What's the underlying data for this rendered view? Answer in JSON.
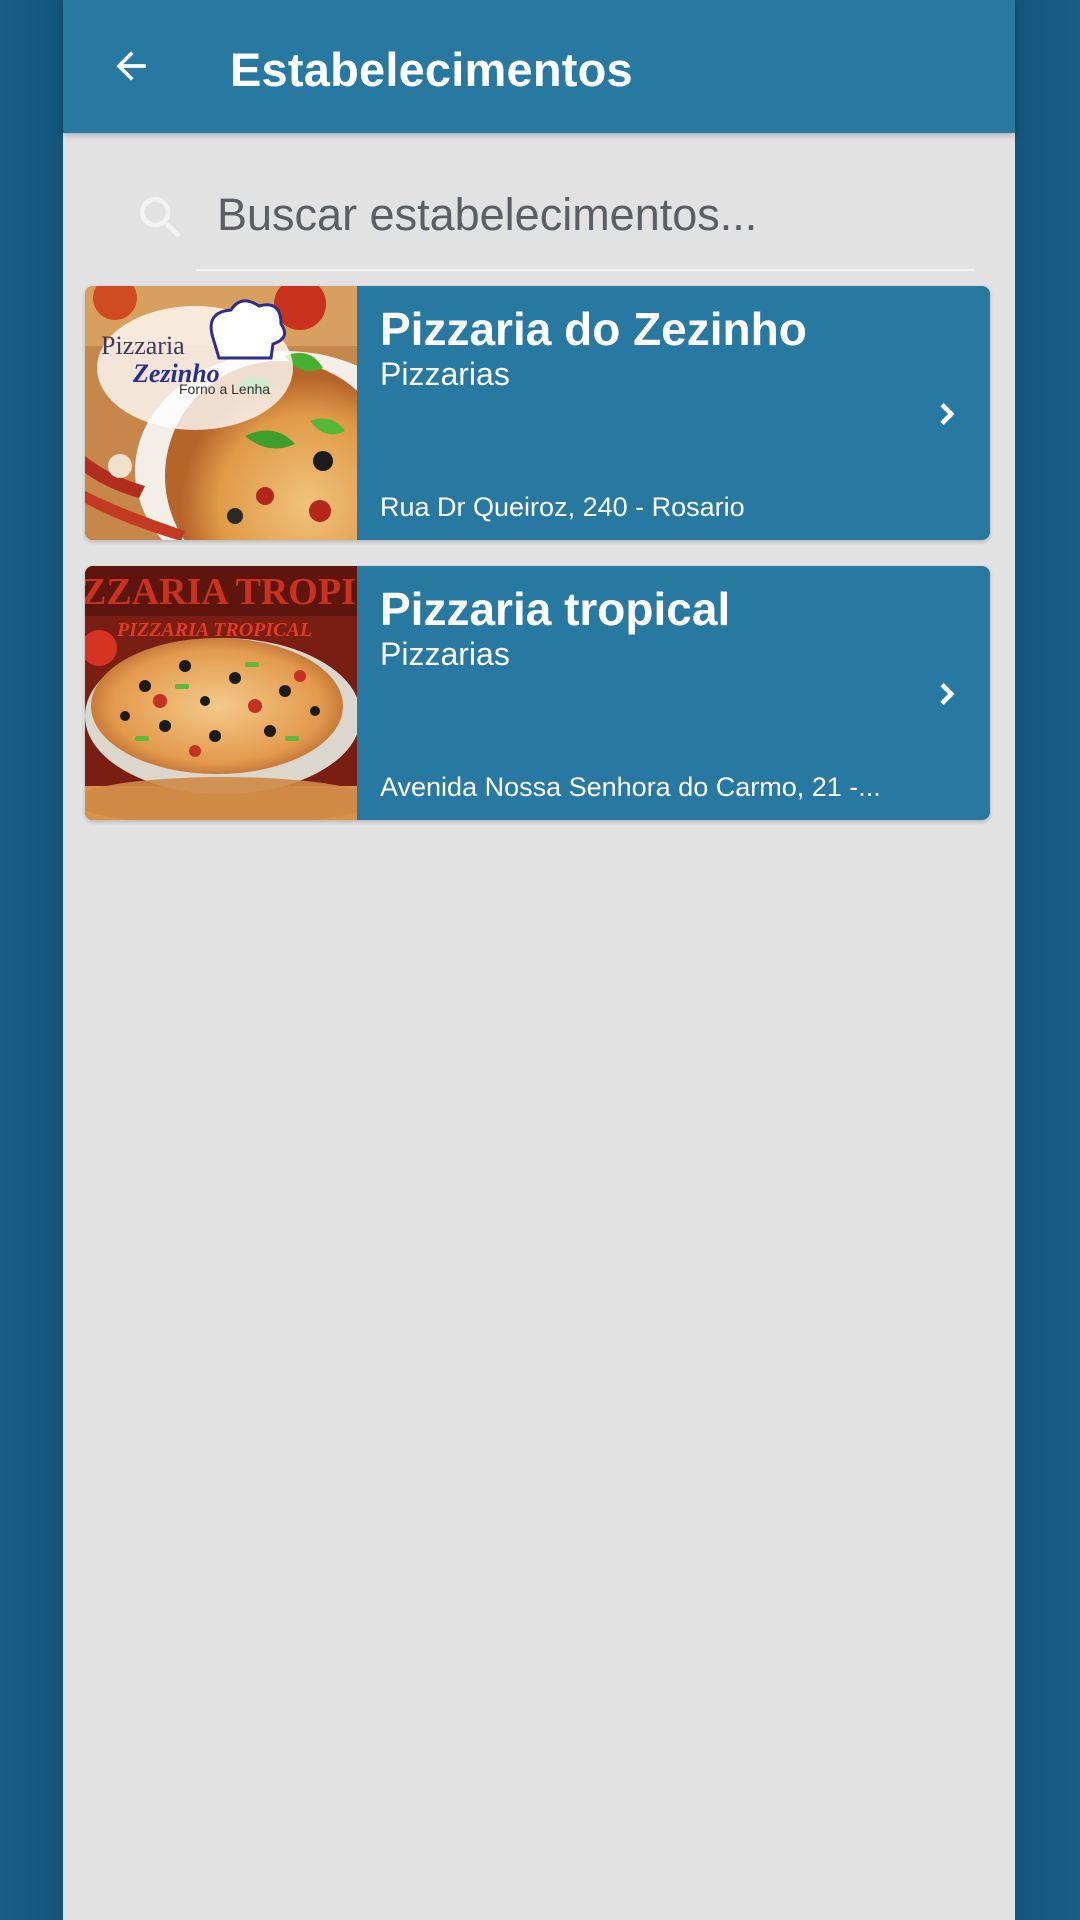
{
  "appbar": {
    "title": "Estabelecimentos",
    "back_icon": "arrow-left-icon",
    "color": "#2779a1"
  },
  "search": {
    "placeholder": "Buscar estabelecimentos...",
    "value": "",
    "icon": "search-icon"
  },
  "establishments": [
    {
      "name": "Pizzaria do Zezinho",
      "category": "Pizzarias",
      "address": "Rua Dr Queiroz, 240 - Rosario",
      "image_text": {
        "line1": "Pizzaria",
        "line2": "Zezinho",
        "line3": "Forno a Lenha"
      }
    },
    {
      "name": "Pizzaria tropical",
      "category": "Pizzarias",
      "address": "Avenida Nossa Senhora do Carmo, 21 -...",
      "image_text": {
        "line1": "ZZARIA TROPI",
        "line2": "PIZZARIA TROPICAL"
      }
    }
  ],
  "colors": {
    "background": "#e2e2e3",
    "card": "#2779a1",
    "outer": "#1a5e86"
  }
}
